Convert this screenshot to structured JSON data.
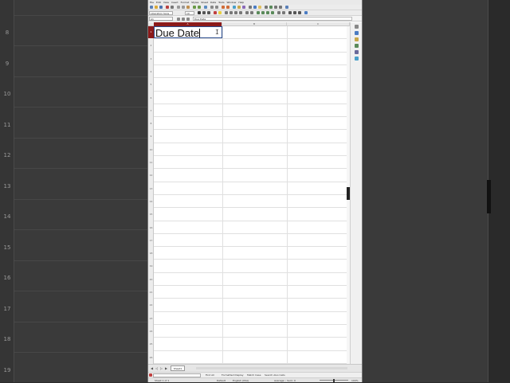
{
  "background": {
    "row_numbers": [
      "8",
      "9",
      "10",
      "11",
      "12",
      "13",
      "14",
      "15",
      "16",
      "17",
      "18",
      "19"
    ]
  },
  "menubar": {
    "items": [
      "File",
      "Edit",
      "View",
      "Insert",
      "Format",
      "Styles",
      "Sheet",
      "Data",
      "Tools",
      "Window",
      "Help"
    ]
  },
  "toolbar": {
    "name_box": "Liberation Sans",
    "font_size": "10"
  },
  "formula_bar": {
    "cell_reference": "A1",
    "content": "Due Date"
  },
  "sheet": {
    "columns": [
      "A",
      "B",
      "C"
    ],
    "rows": [
      "1",
      "2",
      "3",
      "4",
      "5",
      "6",
      "7",
      "8",
      "9",
      "10",
      "11",
      "12",
      "13",
      "14",
      "15",
      "16",
      "17",
      "18",
      "19",
      "20",
      "21",
      "22",
      "23",
      "24",
      "25",
      "26"
    ],
    "active_cell_text": "Due Date"
  },
  "tabs": {
    "sheet_name": "Sheet1",
    "nav": [
      "◀",
      "◁",
      "▷",
      "▶"
    ]
  },
  "find_bar": {
    "items": [
      "Find All",
      "Formatted Display",
      "Match Case",
      "Search Also Cells"
    ]
  },
  "status_bar": {
    "sheet_info": "Sheet 1 of 1",
    "mode": "Default",
    "language": "English (USA)",
    "summary": "Average: ; Sum: 0",
    "zoom": "100%"
  },
  "colors": {
    "accent_row": "#8b1a1a",
    "selection_border": "#2a4d8f"
  }
}
